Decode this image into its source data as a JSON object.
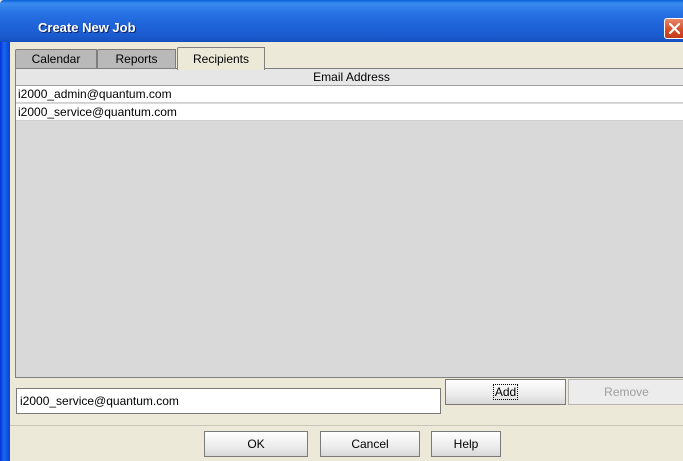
{
  "window": {
    "title": "Create New Job"
  },
  "tabs": [
    {
      "label": "Calendar",
      "active": false
    },
    {
      "label": "Reports",
      "active": false
    },
    {
      "label": "Recipients",
      "active": true
    }
  ],
  "table": {
    "column_header": "Email Address",
    "rows": [
      {
        "email": "i2000_admin@quantum.com"
      },
      {
        "email": "i2000_service@quantum.com"
      }
    ]
  },
  "entry": {
    "email_value": "i2000_service@quantum.com",
    "add_label": "Add",
    "remove_label": "Remove"
  },
  "buttons": {
    "ok_label": "OK",
    "cancel_label": "Cancel",
    "help_label": "Help"
  },
  "icons": {
    "close": "close-icon"
  },
  "colors": {
    "titlebar": "#2873e6",
    "close": "#d44b25",
    "client": "#ece9d8"
  }
}
